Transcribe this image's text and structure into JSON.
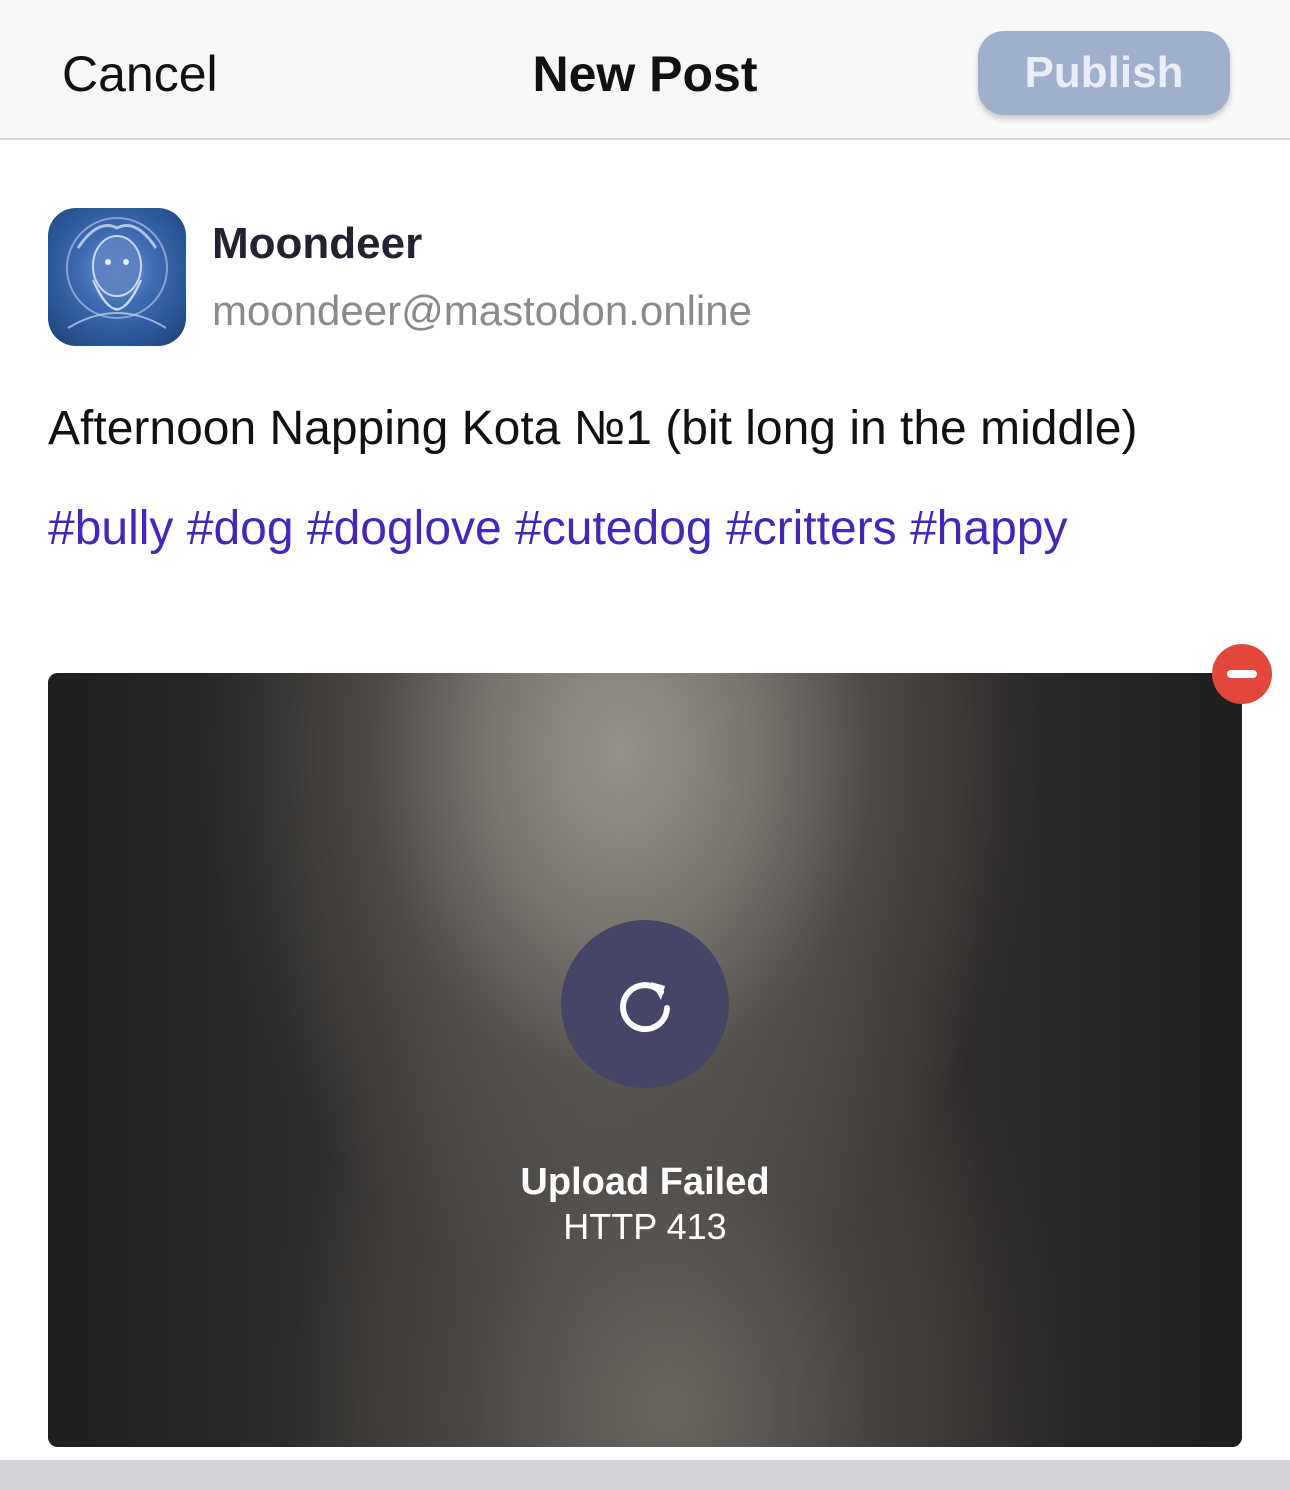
{
  "nav": {
    "cancel_label": "Cancel",
    "title": "New Post",
    "publish_label": "Publish",
    "publish_color": "#9eb0cb"
  },
  "author": {
    "display_name": "Moondeer",
    "handle": "moondeer@mastodon.online",
    "avatar_icon": "avatar-image"
  },
  "post": {
    "text": "Afternoon Napping Kota №1 (bit long in the middle)",
    "hashtags": [
      "#bully",
      "#dog",
      "#doglove",
      "#cutedog",
      "#critters",
      "#happy"
    ],
    "hashtag_color": "#4526b8"
  },
  "attachment": {
    "status_title": "Upload Failed",
    "status_detail": "HTTP 413",
    "retry_icon": "retry-icon",
    "remove_icon": "remove-minus-icon",
    "remove_color": "#e2473b"
  }
}
